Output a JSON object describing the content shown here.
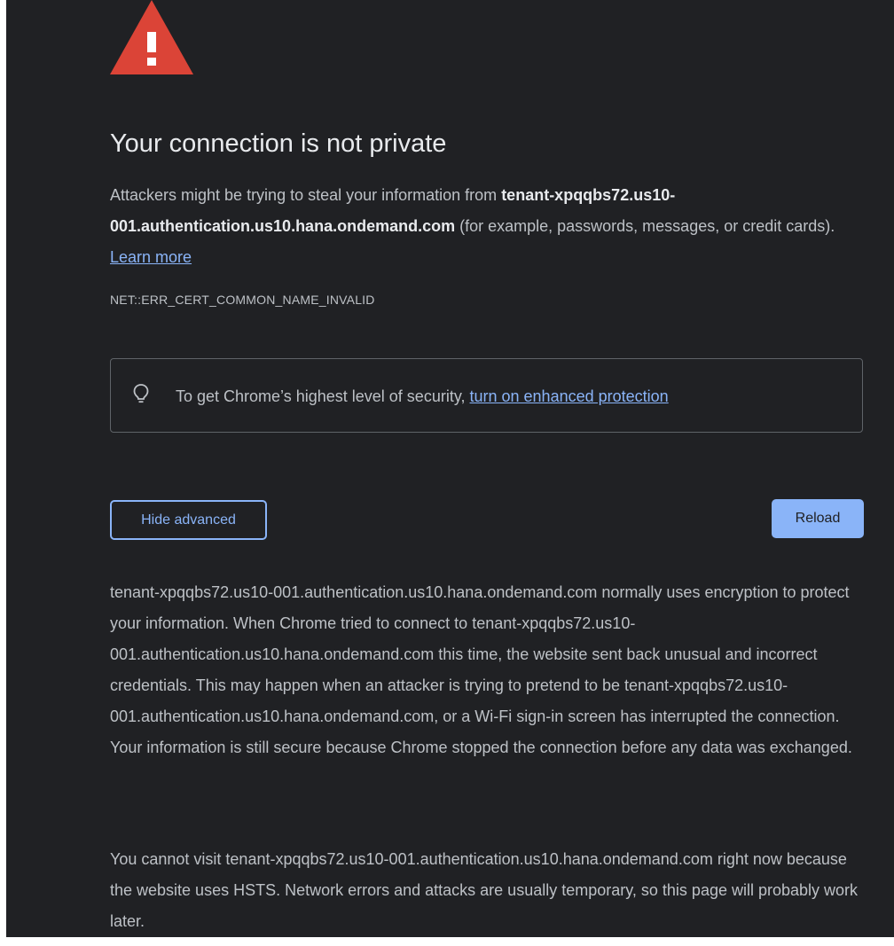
{
  "colors": {
    "page_bg": "#202124",
    "warning_red": "#db4437",
    "link": "#8ab4f8",
    "title_text": "#e8eaed",
    "body_text": "#bdc1c6"
  },
  "header": {
    "icon": "warning-triangle-icon",
    "title": "Your connection is not private"
  },
  "intro": {
    "prefix": "Attackers might be trying to steal your information from ",
    "host": "tenant-xpqqbs72.us10-001.authentication.us10.hana.ondemand.com",
    "suffix": " (for example, passwords, messages, or credit cards). ",
    "learn_more": "Learn more"
  },
  "error_code": "NET::ERR_CERT_COMMON_NAME_INVALID",
  "enhanced": {
    "icon": "lightbulb-icon",
    "prefix": "To get Chrome’s highest level of security, ",
    "link": "turn on enhanced protection"
  },
  "buttons": {
    "hide_advanced": "Hide advanced",
    "reload": "Reload"
  },
  "details": "tenant-xpqqbs72.us10-001.authentication.us10.hana.ondemand.com normally uses encryption to protect your information. When Chrome tried to connect to tenant-xpqqbs72.us10-001.authentication.us10.hana.ondemand.com this time, the website sent back unusual and incorrect credentials. This may happen when an attacker is trying to pretend to be tenant-xpqqbs72.us10-001.authentication.us10.hana.ondemand.com, or a Wi-Fi sign-in screen has interrupted the connection. Your information is still secure because Chrome stopped the connection before any data was exchanged.",
  "hsts": "You cannot visit tenant-xpqqbs72.us10-001.authentication.us10.hana.ondemand.com right now because the website uses HSTS. Network errors and attacks are usually temporary, so this page will probably work later."
}
